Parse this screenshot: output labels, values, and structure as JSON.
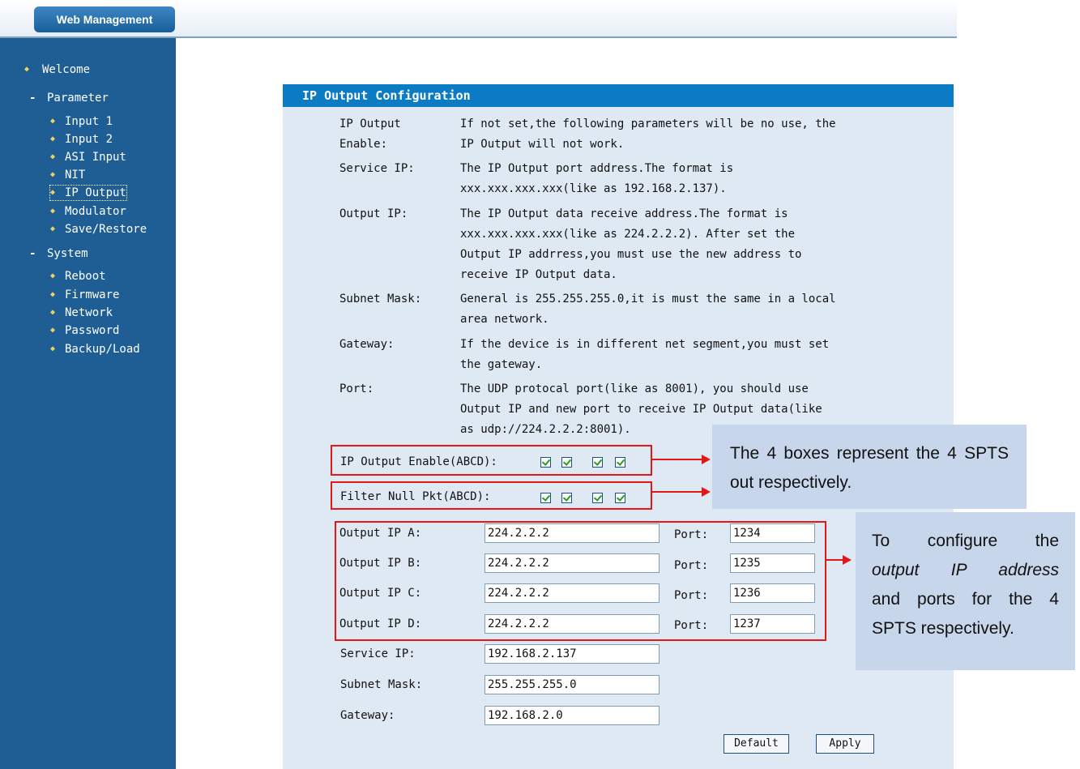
{
  "header": {
    "brand": "Web Management"
  },
  "sidebar": {
    "welcome": "Welcome",
    "parameter": "Parameter",
    "parameter_items": [
      "Input 1",
      "Input 2",
      "ASI Input",
      "NIT",
      "IP Output",
      "Modulator",
      "Save/Restore"
    ],
    "system": "System",
    "system_items": [
      "Reboot",
      "Firmware",
      "Network",
      "Password",
      "Backup/Load"
    ],
    "active_item": "IP Output"
  },
  "panel": {
    "title": "IP Output Configuration",
    "help": [
      {
        "label_lines": [
          "IP Output",
          "Enable:"
        ],
        "text_lines": [
          "If not set,the following parameters will be no use, the",
          "IP Output will not work."
        ]
      },
      {
        "label_lines": [
          "Service IP:"
        ],
        "text_lines": [
          "The IP Output port address.The format is",
          "xxx.xxx.xxx.xxx(like as 192.168.2.137)."
        ]
      },
      {
        "label_lines": [
          "Output IP:"
        ],
        "text_lines": [
          "The IP Output data receive address.The format is",
          "xxx.xxx.xxx.xxx(like as 224.2.2.2). After set the",
          "Output IP addrress,you must use the new address to",
          "receive IP Output data."
        ]
      },
      {
        "label_lines": [
          "Subnet Mask:"
        ],
        "text_lines": [
          "General is 255.255.255.0,it is must the same in a local",
          "area network."
        ]
      },
      {
        "label_lines": [
          "Gateway:"
        ],
        "text_lines": [
          "If the device is in different net segment,you must set",
          "the gateway."
        ]
      },
      {
        "label_lines": [
          "Port:"
        ],
        "text_lines": [
          "The UDP protocal port(like as 8001), you should use",
          "Output IP and new port to receive IP Output data(like",
          "as udp://224.2.2.2:8001)."
        ]
      }
    ],
    "enable_label": "IP Output Enable(ABCD):",
    "enable_checks": [
      true,
      true,
      true,
      true
    ],
    "filter_label": "Filter Null Pkt(ABCD):",
    "filter_checks": [
      true,
      true,
      true,
      true
    ],
    "outputs": [
      {
        "label": "Output IP A:",
        "ip": "224.2.2.2",
        "port_label": "Port:",
        "port": "1234"
      },
      {
        "label": "Output IP B:",
        "ip": "224.2.2.2",
        "port_label": "Port:",
        "port": "1235"
      },
      {
        "label": "Output IP C:",
        "ip": "224.2.2.2",
        "port_label": "Port:",
        "port": "1236"
      },
      {
        "label": "Output IP D:",
        "ip": "224.2.2.2",
        "port_label": "Port:",
        "port": "1237"
      }
    ],
    "service_ip_label": "Service IP:",
    "service_ip": "192.168.2.137",
    "subnet_label": "Subnet Mask:",
    "subnet": "255.255.255.0",
    "gateway_label": "Gateway:",
    "gateway": "192.168.2.0",
    "default_button": "Default",
    "apply_button": "Apply"
  },
  "annotations": {
    "callout1": "The 4 boxes represent the 4 SPTS out respectively.",
    "callout2_lines": [
      "To configure the",
      "output IP address",
      "and ports for the 4",
      "SPTS respectively."
    ]
  },
  "colors": {
    "sidebar": "#1e5e95",
    "panel_header": "#0b7bc3",
    "panel_bg": "#dfe9f4",
    "annotation_red": "#e01818",
    "callout_bg": "#c7d6ea",
    "bullet": "#e8d45a"
  }
}
